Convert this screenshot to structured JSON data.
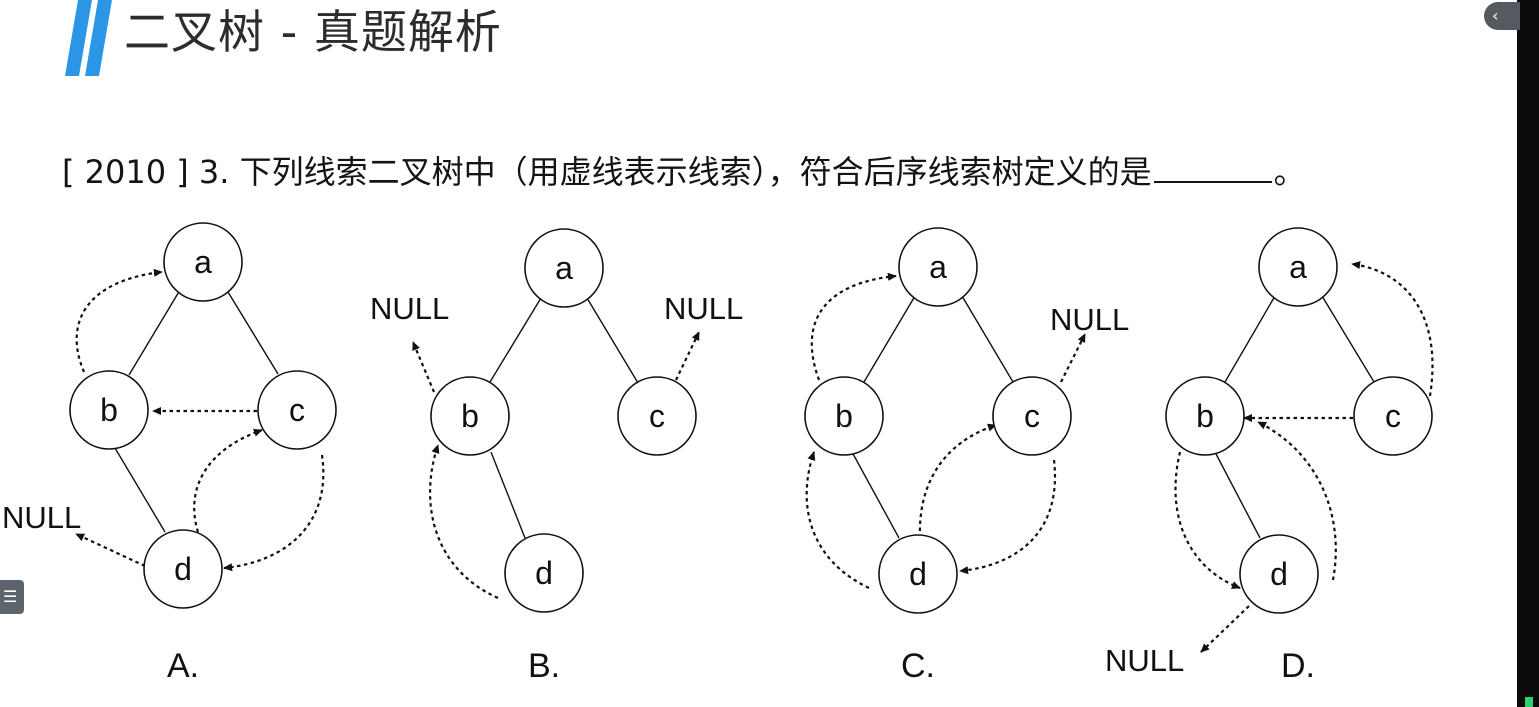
{
  "header": {
    "title": "二叉树 - 真题解析"
  },
  "question": {
    "prefix": "[ 2010 ] 3. 下列线索二叉树中（用虚线表示线索），符合后序线索树定义的是",
    "suffix": "。"
  },
  "colors": {
    "accent_blue": "#2c96e6",
    "node_stroke": "#111111",
    "text": "#141414"
  },
  "icons": {
    "collapse": "chevron-left-icon",
    "toc": "list-icon"
  },
  "diagram": {
    "null_text": "NULL",
    "options": [
      {
        "label": "A.",
        "nodes": [
          "a",
          "b",
          "c",
          "d"
        ],
        "edges": [
          [
            "a",
            "b"
          ],
          [
            "a",
            "c"
          ],
          [
            "b",
            "d"
          ]
        ],
        "threads": [
          [
            "b",
            "a"
          ],
          [
            "c",
            "b"
          ],
          [
            "c",
            "d"
          ],
          [
            "d",
            "c"
          ],
          [
            "d",
            "NULL"
          ]
        ]
      },
      {
        "label": "B.",
        "nodes": [
          "a",
          "b",
          "c",
          "d"
        ],
        "edges": [
          [
            "a",
            "b"
          ],
          [
            "a",
            "c"
          ],
          [
            "b",
            "d"
          ]
        ],
        "threads": [
          [
            "b",
            "NULL"
          ],
          [
            "c",
            "NULL"
          ],
          [
            "d",
            "b"
          ]
        ]
      },
      {
        "label": "C.",
        "nodes": [
          "a",
          "b",
          "c",
          "d"
        ],
        "edges": [
          [
            "a",
            "b"
          ],
          [
            "a",
            "c"
          ],
          [
            "b",
            "d"
          ]
        ],
        "threads": [
          [
            "b",
            "a"
          ],
          [
            "c",
            "NULL"
          ],
          [
            "c",
            "d"
          ],
          [
            "d",
            "c"
          ],
          [
            "d",
            "b"
          ]
        ]
      },
      {
        "label": "D.",
        "nodes": [
          "a",
          "b",
          "c",
          "d"
        ],
        "edges": [
          [
            "a",
            "b"
          ],
          [
            "a",
            "c"
          ],
          [
            "b",
            "d"
          ]
        ],
        "threads": [
          [
            "c",
            "a"
          ],
          [
            "c",
            "b"
          ],
          [
            "b",
            "d"
          ],
          [
            "d",
            "b"
          ],
          [
            "d",
            "NULL"
          ]
        ]
      }
    ]
  }
}
